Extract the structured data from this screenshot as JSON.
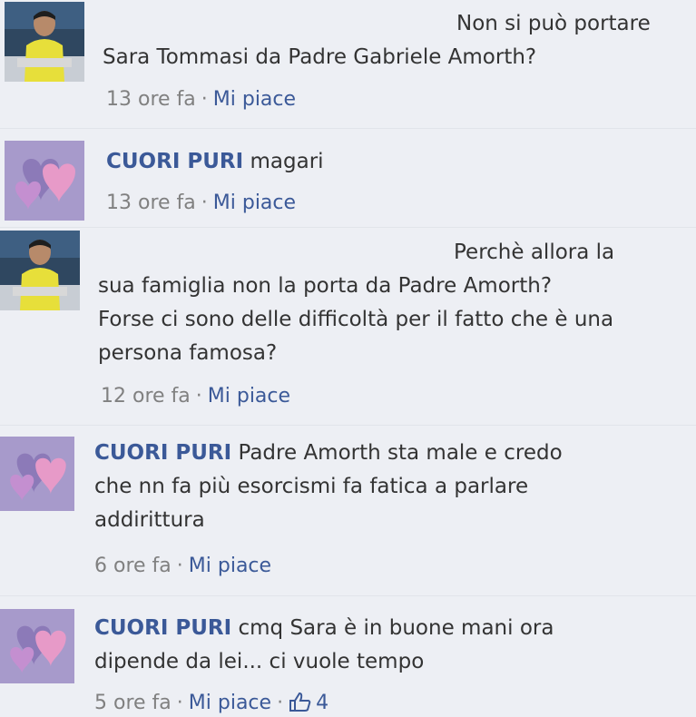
{
  "comments": [
    {
      "author": "",
      "text_lines": [
        "Non si può portare",
        "Sara Tommasi da Padre Gabriele Amorth?"
      ],
      "time": "13 ore fa",
      "like_label": "Mi piace",
      "avatar": "user-photo-yellow-shirt"
    },
    {
      "author": "CUORI PURI",
      "text_lines": [
        "magari"
      ],
      "time": "13 ore fa",
      "like_label": "Mi piace",
      "avatar": "cuori-puri-hearts-logo"
    },
    {
      "author": "",
      "text_lines": [
        "Perchè allora la",
        "sua famiglia non la porta da Padre Amorth?",
        "Forse ci sono delle difficoltà per il fatto che è una",
        "persona famosa?"
      ],
      "time": "12 ore fa",
      "like_label": "Mi piace",
      "avatar": "user-photo-yellow-shirt"
    },
    {
      "author": "CUORI PURI",
      "text_lines": [
        "Padre Amorth sta male e credo",
        "che nn fa più esorcismi fa fatica a parlare",
        "addirittura"
      ],
      "time": "6 ore fa",
      "like_label": "Mi piace",
      "avatar": "cuori-puri-hearts-logo"
    },
    {
      "author": "CUORI PURI",
      "text_lines": [
        "cmq Sara è in buone mani ora",
        "dipende da lei... ci vuole tempo"
      ],
      "time": "5 ore fa",
      "like_label": "Mi piace",
      "like_count": "4",
      "avatar": "cuori-puri-hearts-logo"
    }
  ],
  "colors": {
    "background": "#edeff4",
    "link": "#3b5998",
    "text": "#333333",
    "meta": "#808080"
  }
}
